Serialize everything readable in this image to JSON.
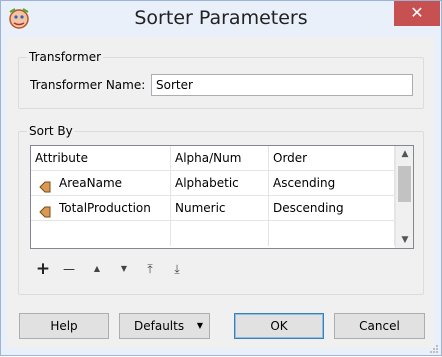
{
  "window": {
    "title": "Sorter Parameters",
    "close_glyph": "✕"
  },
  "transformer": {
    "group_title": "Transformer",
    "name_label": "Transformer Name:",
    "name_value": "Sorter"
  },
  "sort_by": {
    "group_title": "Sort By",
    "columns": [
      "Attribute",
      "Alpha/Num",
      "Order"
    ],
    "rows": [
      {
        "attribute": "AreaName",
        "alpha_num": "Alphabetic",
        "order": "Ascending"
      },
      {
        "attribute": "TotalProduction",
        "alpha_num": "Numeric",
        "order": "Descending"
      }
    ]
  },
  "toolbar": {
    "add": "+",
    "remove": "—",
    "up": "▲",
    "down": "▼",
    "top": "⤒",
    "bottom": "⤓"
  },
  "buttons": {
    "help": "Help",
    "defaults": "Defaults",
    "defaults_caret": "▼",
    "ok": "OK",
    "cancel": "Cancel"
  }
}
